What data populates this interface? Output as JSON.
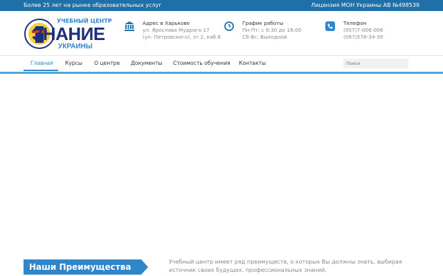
{
  "topbar": {
    "left_text": "Более 25 лет на рынке образовательных услуг",
    "right_text": "Лицензия МОН Украины АВ №498539"
  },
  "logo": {
    "top": "УЧЕБНЫЙ ЦЕНТР",
    "main": "ЗНАНИЕ",
    "sub": "УКРАИНЫ"
  },
  "contacts": {
    "address": {
      "icon": "bank-icon",
      "title": "Адрес в Харькове",
      "line1": "ул. Ярослава Мудрого 17",
      "line2": "(ул. Петровского), эт.2, каб.6"
    },
    "schedule": {
      "icon": "clock-icon",
      "title": "График работы",
      "line1": "Пн-Пт: с 9:30 до 18:00",
      "line2": "Сб-Вс: Выходной"
    },
    "phone": {
      "icon": "phone-icon",
      "title": "Телефон",
      "line1": "(057)7-006-006",
      "line2": "(067)578-34-39"
    }
  },
  "nav": {
    "items": [
      {
        "label": "Главная"
      },
      {
        "label": "Курсы"
      },
      {
        "label": "О центре"
      },
      {
        "label": "Документы"
      },
      {
        "label": "Стоимость обучения"
      },
      {
        "label": "Контакты"
      }
    ],
    "search_placeholder": "Поиск"
  },
  "advantages": {
    "title": "Наши Преимущества",
    "text": "Учебный центр имеет ряд преимуществ, о которых Вы должны знать, выбирая источник своих будущих, профессиональных знаний."
  },
  "colors": {
    "primary": "#1f6fa8",
    "accent": "#2f86c8",
    "light_accent": "#4aa6dc"
  }
}
